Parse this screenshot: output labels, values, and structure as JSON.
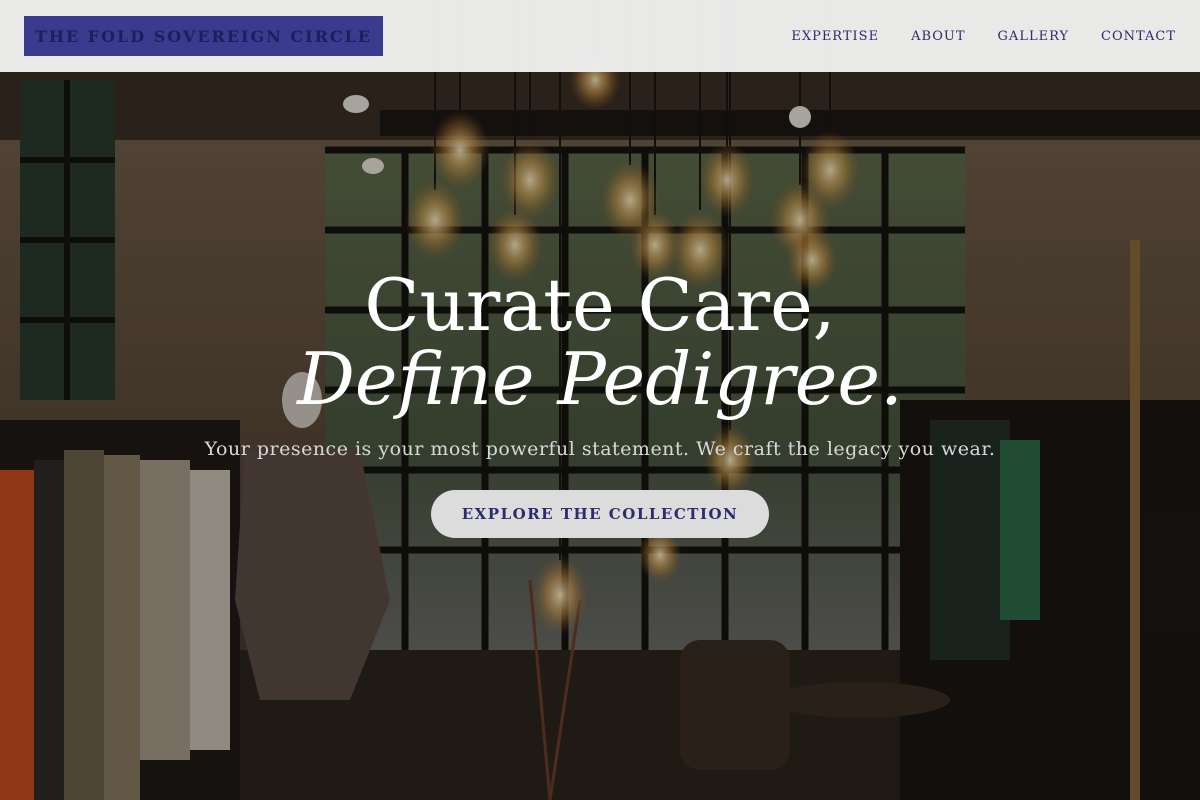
{
  "header": {
    "logo_text": "THE FOLD SOVEREIGN CIRCLE",
    "nav": [
      {
        "label": "EXPERTISE"
      },
      {
        "label": "ABOUT"
      },
      {
        "label": "GALLERY"
      },
      {
        "label": "CONTACT"
      }
    ]
  },
  "hero": {
    "title_line1": "Curate Care,",
    "title_line2": "Define Pedigree.",
    "subtitle": "Your presence is your most powerful statement. We craft the legacy you wear.",
    "cta_label": "EXPLORE THE COLLECTION"
  },
  "colors": {
    "header_bg": "#f0f0f0",
    "logo_bg": "#3a3a8e",
    "nav_text": "#2b2b6e",
    "cta_bg": "#dcdcdc",
    "cta_text": "#2b2b6e"
  }
}
